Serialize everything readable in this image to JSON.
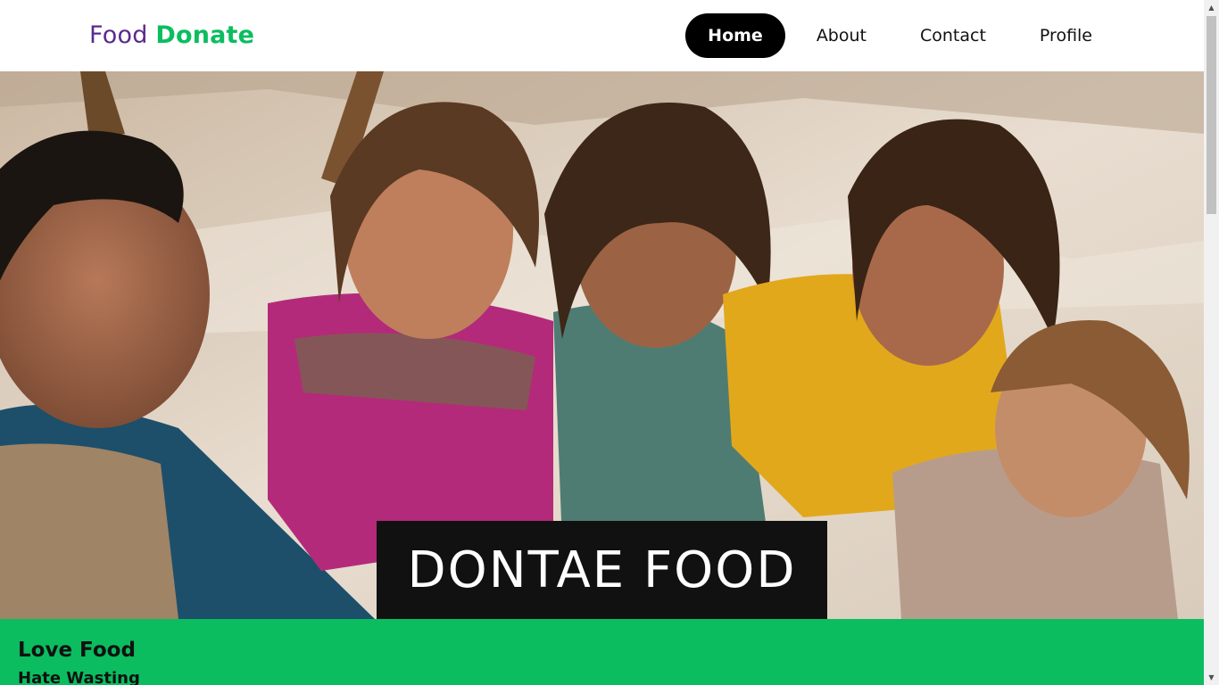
{
  "logo": {
    "first": "Food",
    "second": "Donate"
  },
  "nav": {
    "items": [
      {
        "label": "Home",
        "active": true
      },
      {
        "label": "About",
        "active": false
      },
      {
        "label": "Contact",
        "active": false
      },
      {
        "label": "Profile",
        "active": false
      }
    ]
  },
  "hero": {
    "title": "DONTAE FOOD"
  },
  "banner": {
    "heading": "Love Food",
    "subheading": "Hate Wasting"
  },
  "colors": {
    "brand_purple": "#5a2a8e",
    "brand_green": "#0bbd5f",
    "nav_active_bg": "#000000",
    "title_box_bg": "#111111"
  },
  "scrollbar": {
    "position_fraction": 0.0
  }
}
